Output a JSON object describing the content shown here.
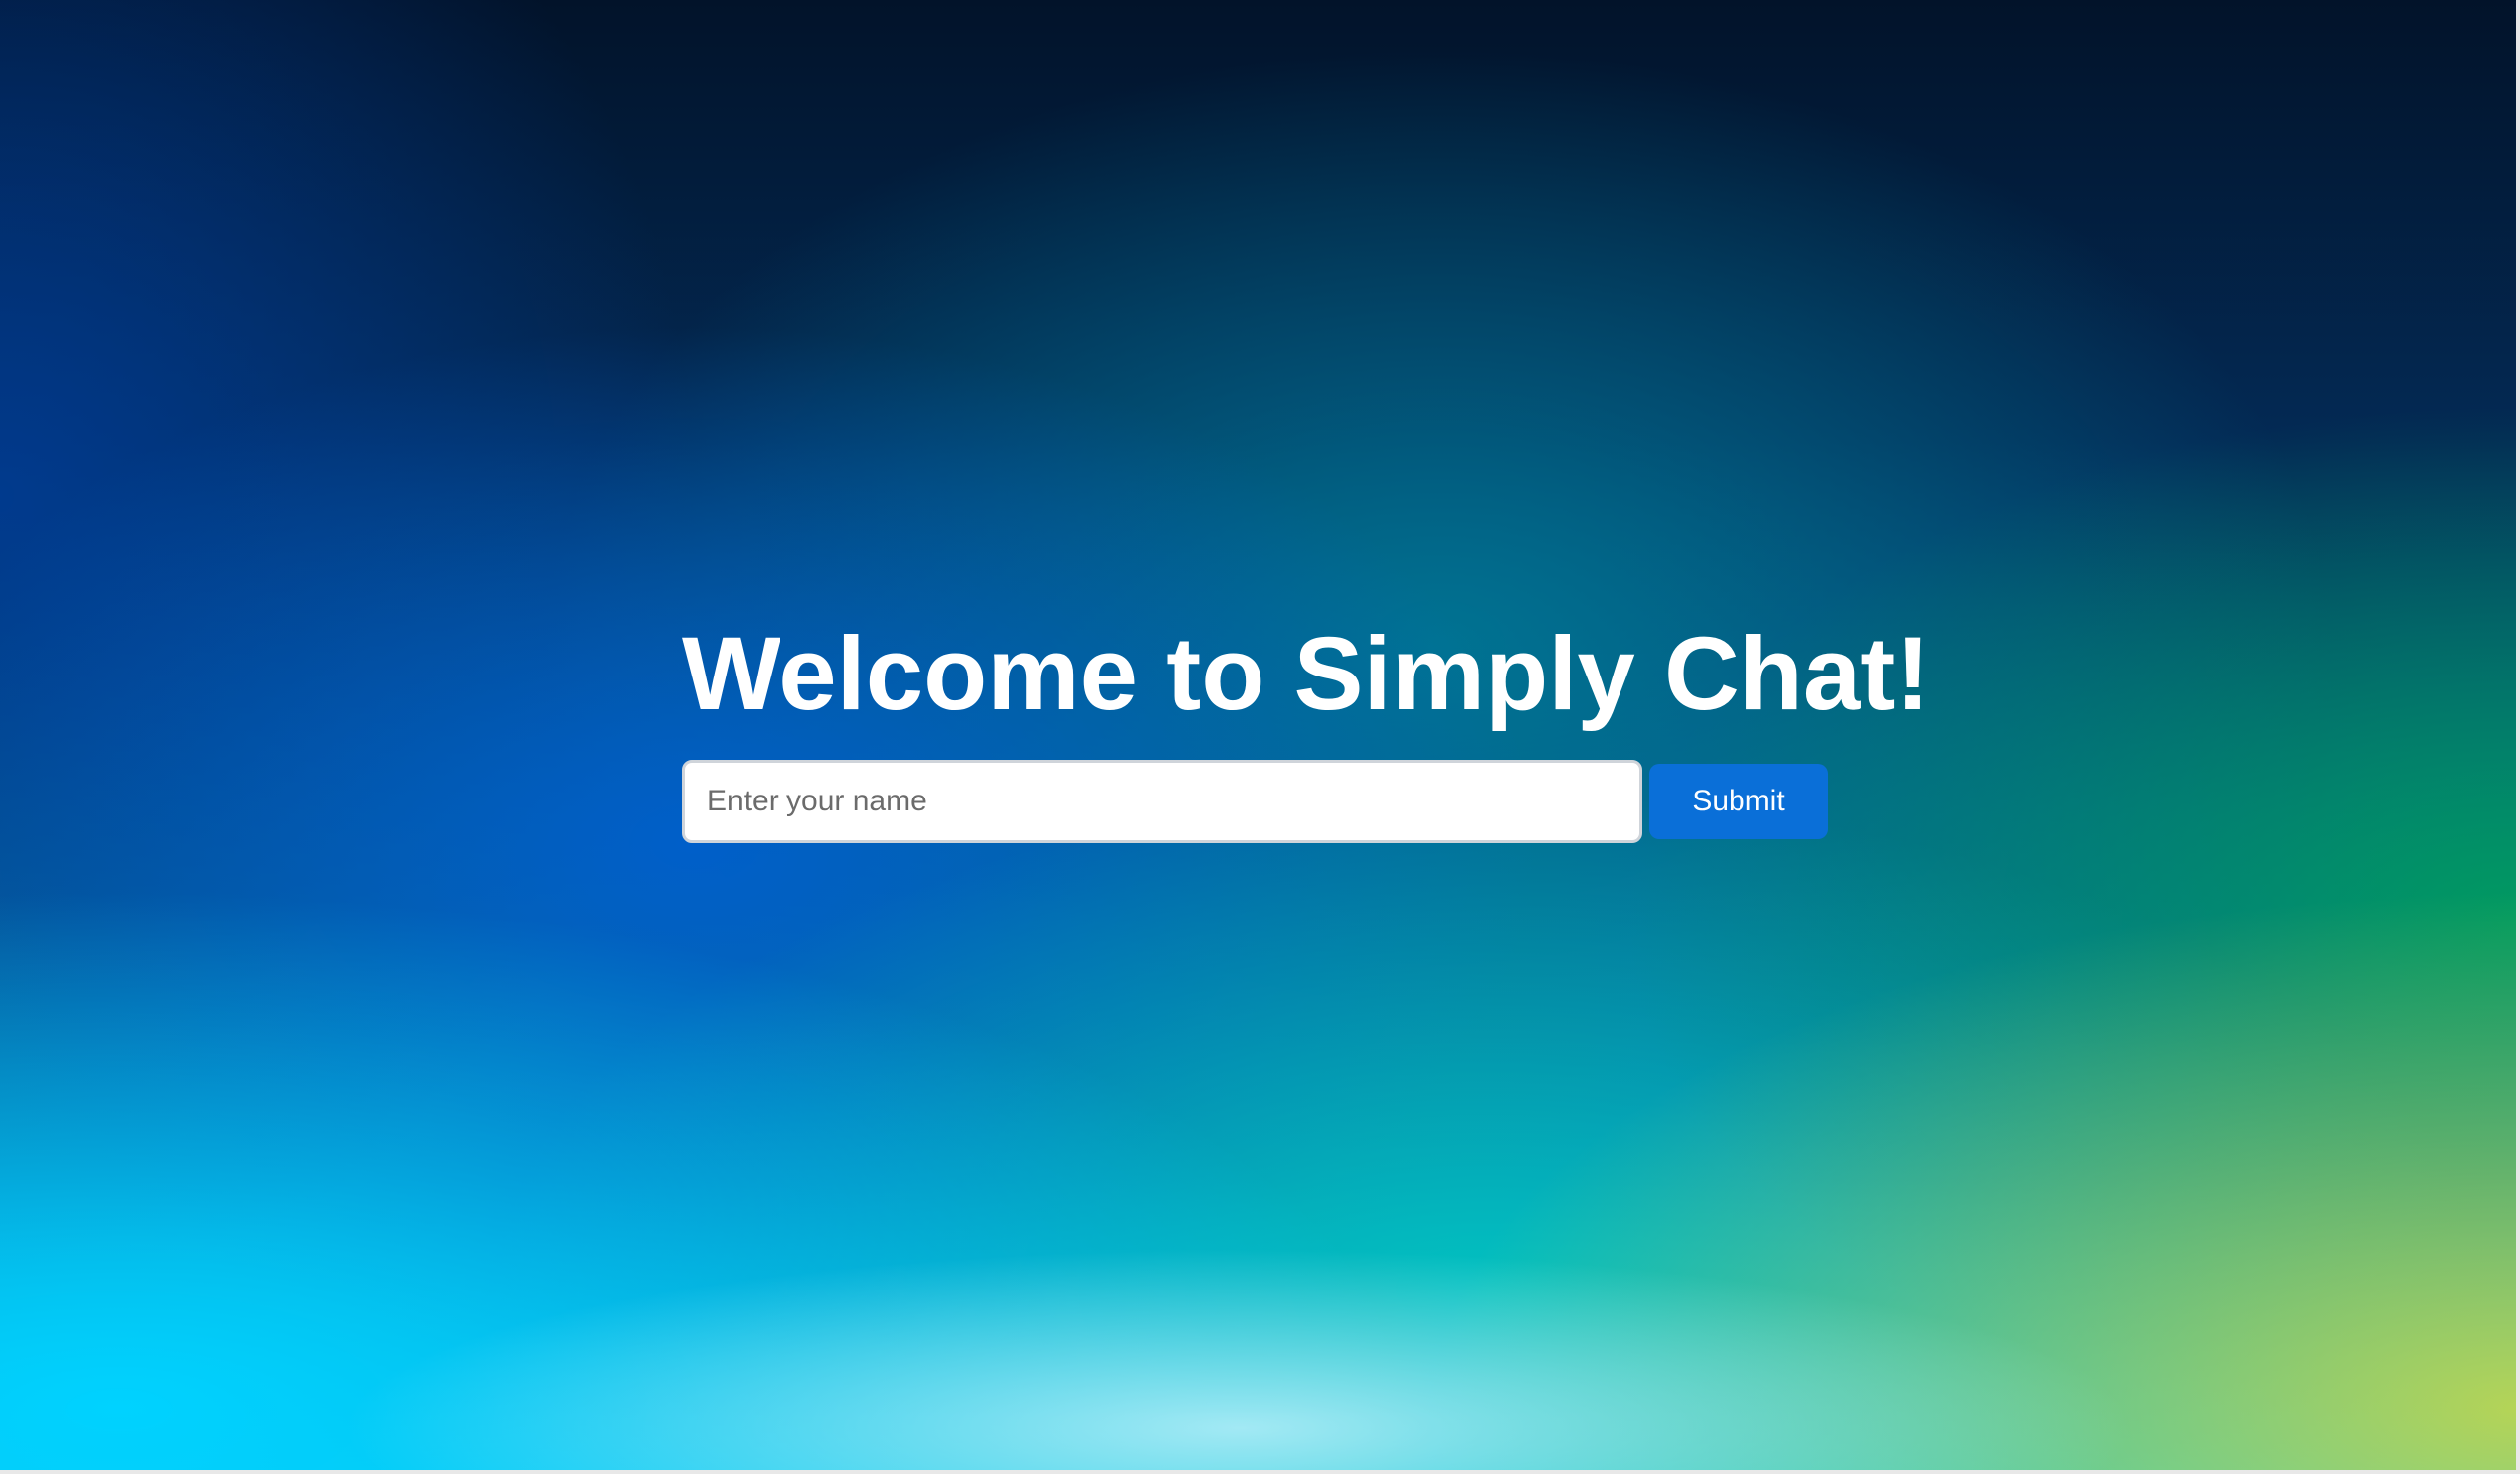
{
  "page": {
    "title": "Welcome to Simply Chat!"
  },
  "form": {
    "name_placeholder": "Enter your name",
    "name_value": "",
    "submit_label": "Submit"
  },
  "colors": {
    "submit_button": "#0a6fd8",
    "title_text": "#ffffff",
    "background_top": "#02132a",
    "background_bottom_left": "#00d2ff",
    "background_bottom_right": "#bed650"
  }
}
